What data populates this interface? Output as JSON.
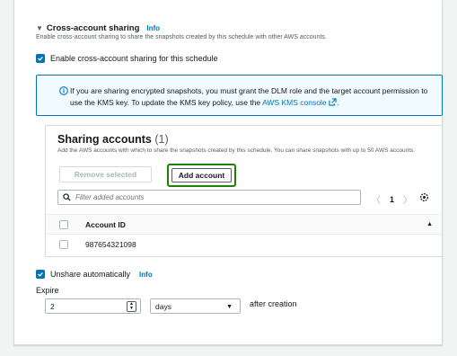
{
  "section": {
    "title": "Cross-account sharing",
    "info": "Info",
    "description": "Enable cross-account sharing to share the snapshots created by this schedule with other AWS accounts."
  },
  "enable_sharing": {
    "label": "Enable cross-account sharing for this schedule",
    "checked": true
  },
  "alert": {
    "text": "If you are sharing encrypted snapshots, you must grant the DLM role and the target account permission to use the KMS key. To update the KMS key policy, use the",
    "link": "AWS KMS console",
    "suffix": "."
  },
  "sharing_accounts": {
    "title": "Sharing accounts",
    "count": "(1)",
    "description": "Add the AWS accounts with which to share the snapshots created by this schedule. You can share snapshots with up to 50 AWS accounts.",
    "remove_label": "Remove selected",
    "add_label": "Add account",
    "filter_placeholder": "Filter added accounts",
    "page": "1",
    "column_header": "Account ID",
    "rows": [
      {
        "account_id": "987654321098",
        "checked": false
      }
    ]
  },
  "unshare": {
    "label": "Unshare automatically",
    "info": "Info",
    "checked": true
  },
  "expire": {
    "label": "Expire",
    "value": "2",
    "unit": "days",
    "suffix": "after creation"
  },
  "colors": {
    "accent": "#0073bb",
    "highlight": "#1d8102"
  }
}
